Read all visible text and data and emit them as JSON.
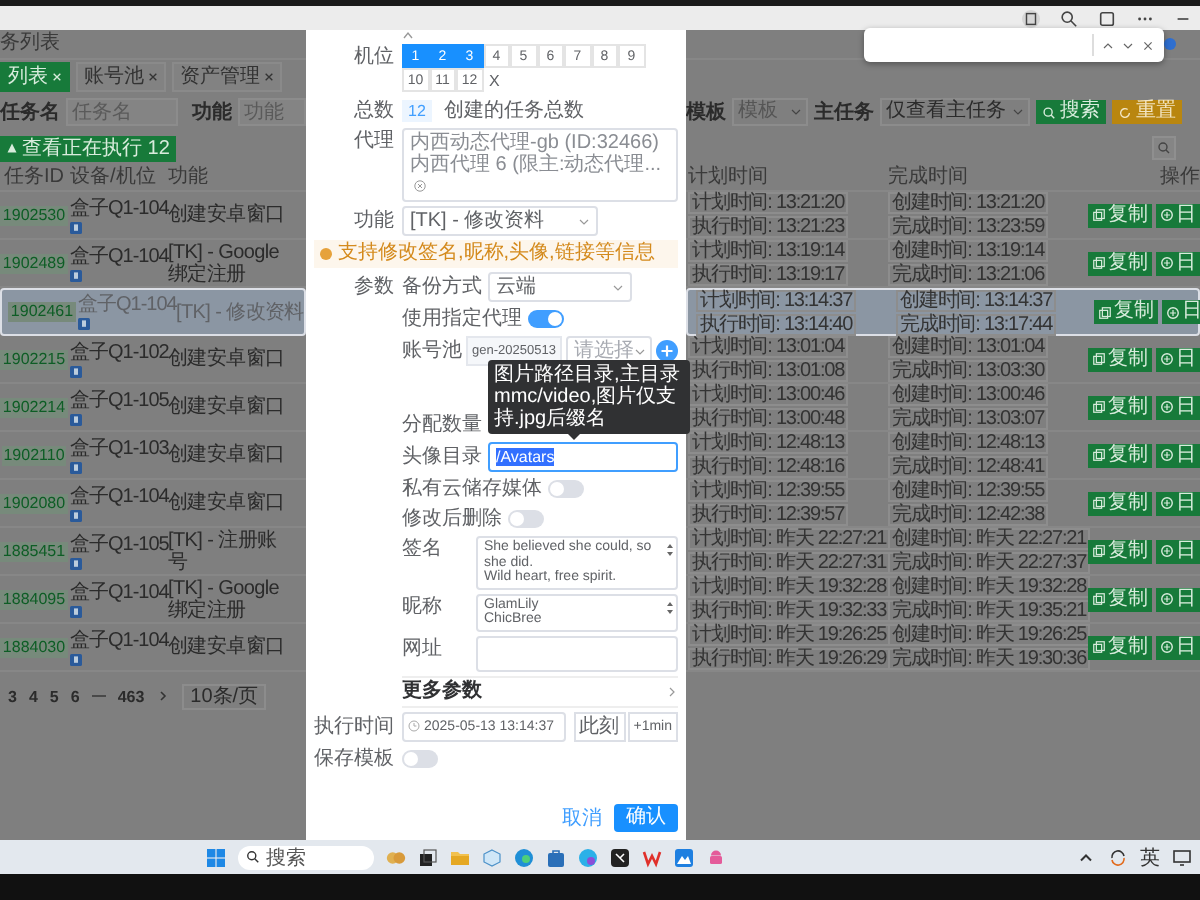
{
  "page": {
    "breadcrumb": "务列表",
    "tabs": [
      {
        "label": "列表",
        "selected": true
      },
      {
        "label": "账号池",
        "selected": false
      },
      {
        "label": "资产管理",
        "selected": false
      }
    ],
    "filters": [
      {
        "label": "任务名",
        "placeholder": "任务名"
      },
      {
        "label": "功能",
        "placeholder": "功能"
      }
    ],
    "right_filters": [
      {
        "label": "模板",
        "placeholder": "模板"
      },
      {
        "label": "主任务",
        "value": "仅查看主任务"
      }
    ],
    "search_button": "搜索",
    "reset_button": "重置",
    "running_button": "查看正在执行 12",
    "columns_left": [
      "任务ID",
      "设备/机位",
      "功能"
    ],
    "columns_right": [
      "计划时间",
      "完成时间",
      "操作"
    ],
    "rows": [
      {
        "id": "1902530",
        "device": "盒子Q1-104",
        "function": "创建安卓窗口",
        "selected": false,
        "plan": "计划时间: 13:21:20",
        "run": "执行时间: 13:21:23",
        "created": "创建时间: 13:21:20",
        "finished": "完成时间: 13:23:59",
        "actions": [
          "复制",
          "日"
        ]
      },
      {
        "id": "1902489",
        "device": "盒子Q1-104",
        "function": "[TK] - Google绑定注册",
        "selected": false,
        "plan": "计划时间: 13:19:14",
        "run": "执行时间: 13:19:17",
        "created": "创建时间: 13:19:14",
        "finished": "完成时间: 13:21:06",
        "actions": [
          "复制",
          "日"
        ]
      },
      {
        "id": "1902461",
        "device": "盒子Q1-104",
        "function": "[TK] - 修改资料",
        "selected": true,
        "plan": "计划时间: 13:14:37",
        "run": "执行时间: 13:14:40",
        "created": "创建时间: 13:14:37",
        "finished": "完成时间: 13:17:44",
        "actions": [
          "复制",
          "日"
        ]
      },
      {
        "id": "1902215",
        "device": "盒子Q1-102",
        "function": "创建安卓窗口",
        "selected": false,
        "plan": "计划时间: 13:01:04",
        "run": "执行时间: 13:01:08",
        "created": "创建时间: 13:01:04",
        "finished": "完成时间: 13:03:30",
        "actions": [
          "复制",
          "日"
        ]
      },
      {
        "id": "1902214",
        "device": "盒子Q1-105",
        "function": "创建安卓窗口",
        "selected": false,
        "plan": "计划时间: 13:00:46",
        "run": "执行时间: 13:00:48",
        "created": "创建时间: 13:00:46",
        "finished": "完成时间: 13:03:07",
        "actions": [
          "复制",
          "日"
        ]
      },
      {
        "id": "1902110",
        "device": "盒子Q1-103",
        "function": "创建安卓窗口",
        "selected": false,
        "plan": "计划时间: 12:48:13",
        "run": "执行时间: 12:48:16",
        "created": "创建时间: 12:48:13",
        "finished": "完成时间: 12:48:41",
        "actions": [
          "复制",
          "日"
        ]
      },
      {
        "id": "1902080",
        "device": "盒子Q1-104",
        "function": "创建安卓窗口",
        "selected": false,
        "plan": "计划时间: 12:39:55",
        "run": "执行时间: 12:39:57",
        "created": "创建时间: 12:39:55",
        "finished": "完成时间: 12:42:38",
        "actions": [
          "复制",
          "日"
        ]
      },
      {
        "id": "1885451",
        "device": "盒子Q1-105",
        "function": "[TK] - 注册账号",
        "selected": false,
        "plan": "计划时间: 昨天 22:27:21",
        "run": "执行时间: 昨天 22:27:31",
        "created": "创建时间: 昨天 22:27:21",
        "finished": "完成时间: 昨天 22:27:37",
        "actions": [
          "复制",
          "日"
        ]
      },
      {
        "id": "1884095",
        "device": "盒子Q1-104",
        "function": "[TK] - Google绑定注册",
        "selected": false,
        "plan": "计划时间: 昨天 19:32:28",
        "run": "执行时间: 昨天 19:32:33",
        "created": "创建时间: 昨天 19:32:28",
        "finished": "完成时间: 昨天 19:35:21",
        "actions": [
          "复制",
          "日"
        ]
      },
      {
        "id": "1884030",
        "device": "盒子Q1-104",
        "function": "创建安卓窗口",
        "selected": false,
        "plan": "计划时间: 昨天 19:26:25",
        "run": "执行时间: 昨天 19:26:29",
        "created": "创建时间: 昨天 19:26:25",
        "finished": "完成时间: 昨天 19:30:36",
        "actions": [
          "复制",
          "日"
        ]
      }
    ],
    "pagination": {
      "pages": [
        "3",
        "4",
        "5",
        "6",
        "463"
      ],
      "page_size": "10条/页"
    }
  },
  "dialog": {
    "seats": {
      "label": "机位",
      "options": [
        {
          "label": "1",
          "selected": true
        },
        {
          "label": "2",
          "selected": true
        },
        {
          "label": "3",
          "selected": true
        },
        {
          "label": "4",
          "selected": false
        },
        {
          "label": "5",
          "selected": false
        },
        {
          "label": "6",
          "selected": false
        },
        {
          "label": "7",
          "selected": false
        },
        {
          "label": "8",
          "selected": false
        },
        {
          "label": "9",
          "selected": false
        },
        {
          "label": "10",
          "selected": false
        },
        {
          "label": "11",
          "selected": false
        },
        {
          "label": "12",
          "selected": false
        }
      ],
      "clear": "X"
    },
    "total": {
      "label": "总数",
      "count": "12",
      "hint": "创建的任务总数"
    },
    "proxy": {
      "label": "代理",
      "value": "内西动态代理-gb (ID:32466) 内西代理 6 (限主:动态代理..."
    },
    "function": {
      "label": "功能",
      "value": "[TK] - 修改资料"
    },
    "notice": "支持修改签名,昵称,头像,链接等信息",
    "params_label": "参数",
    "params": [
      {
        "kind": "select",
        "label": "备份方式",
        "value": "云端"
      },
      {
        "kind": "switch",
        "label": "使用指定代理",
        "on": true
      },
      {
        "kind": "pool",
        "label": "账号池",
        "value": "gen-20250513",
        "placeholder": "请选择"
      },
      {
        "kind": "label",
        "label": "分配数量"
      },
      {
        "kind": "input",
        "label": "头像目录",
        "value": "/Avatars",
        "tooltip": "图片路径目录,主目录mmc/video,图片仅支持.jpg后缀名"
      },
      {
        "kind": "switch",
        "label": "私有云储存媒体",
        "on": false
      },
      {
        "kind": "switch",
        "label": "修改后删除",
        "on": false
      },
      {
        "kind": "textarea",
        "label": "签名",
        "value": "She believed she could, so she did.\nWild heart, free spirit."
      },
      {
        "kind": "textarea",
        "label": "昵称",
        "value": "GlamLily\nChicBree"
      },
      {
        "kind": "textarea",
        "label": "网址"
      },
      {
        "kind": "more",
        "label": "更多参数"
      }
    ],
    "schedule": {
      "label": "执行时间",
      "value": "2025-05-13 13:14:37",
      "buttons": [
        "此刻",
        "+1min"
      ]
    },
    "save_template": {
      "label": "保存模板",
      "on": false
    },
    "cancel": "取消",
    "confirm": "确认"
  },
  "taskbar": {
    "search": "搜索",
    "ime": "英"
  }
}
